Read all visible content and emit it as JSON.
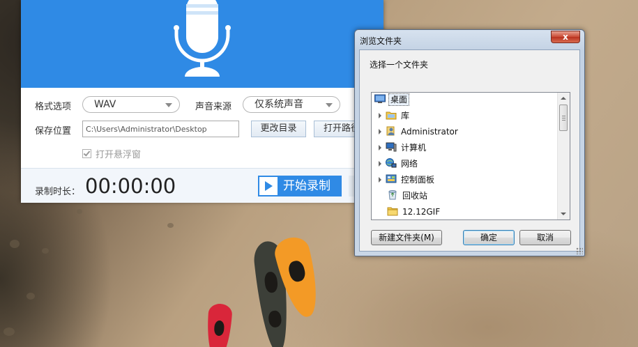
{
  "recorder": {
    "format_label": "格式选项",
    "format_value": "WAV",
    "source_label": "声音来源",
    "source_value": "仅系统声音",
    "save_label": "保存位置",
    "save_path": "C:\\Users\\Administrator\\Desktop",
    "change_dir_button": "更改目录",
    "open_path_button": "打开路径",
    "float_window_label": "打开悬浮窗",
    "float_window_checked": true,
    "duration_label": "录制时长：",
    "duration_value": "00:00:00",
    "start_button": "开始录制",
    "accent_color": "#2f8ae5"
  },
  "dialog": {
    "title": "浏览文件夹",
    "prompt": "选择一个文件夹",
    "close_label": "x",
    "tree": [
      {
        "label": "桌面",
        "icon": "desktop-icon",
        "expandable": false,
        "selected": true
      },
      {
        "label": "库",
        "icon": "library-icon",
        "expandable": true,
        "selected": false
      },
      {
        "label": "Administrator",
        "icon": "user-folder-icon",
        "expandable": true,
        "selected": false
      },
      {
        "label": "计算机",
        "icon": "computer-icon",
        "expandable": true,
        "selected": false
      },
      {
        "label": "网络",
        "icon": "network-icon",
        "expandable": true,
        "selected": false
      },
      {
        "label": "控制面板",
        "icon": "control-panel-icon",
        "expandable": true,
        "selected": false
      },
      {
        "label": "回收站",
        "icon": "recycle-bin-icon",
        "expandable": false,
        "selected": false
      },
      {
        "label": "12.12GIF",
        "icon": "folder-icon",
        "expandable": false,
        "selected": false
      }
    ],
    "new_folder_button": "新建文件夹(M)",
    "ok_button": "确定",
    "cancel_button": "取消"
  }
}
